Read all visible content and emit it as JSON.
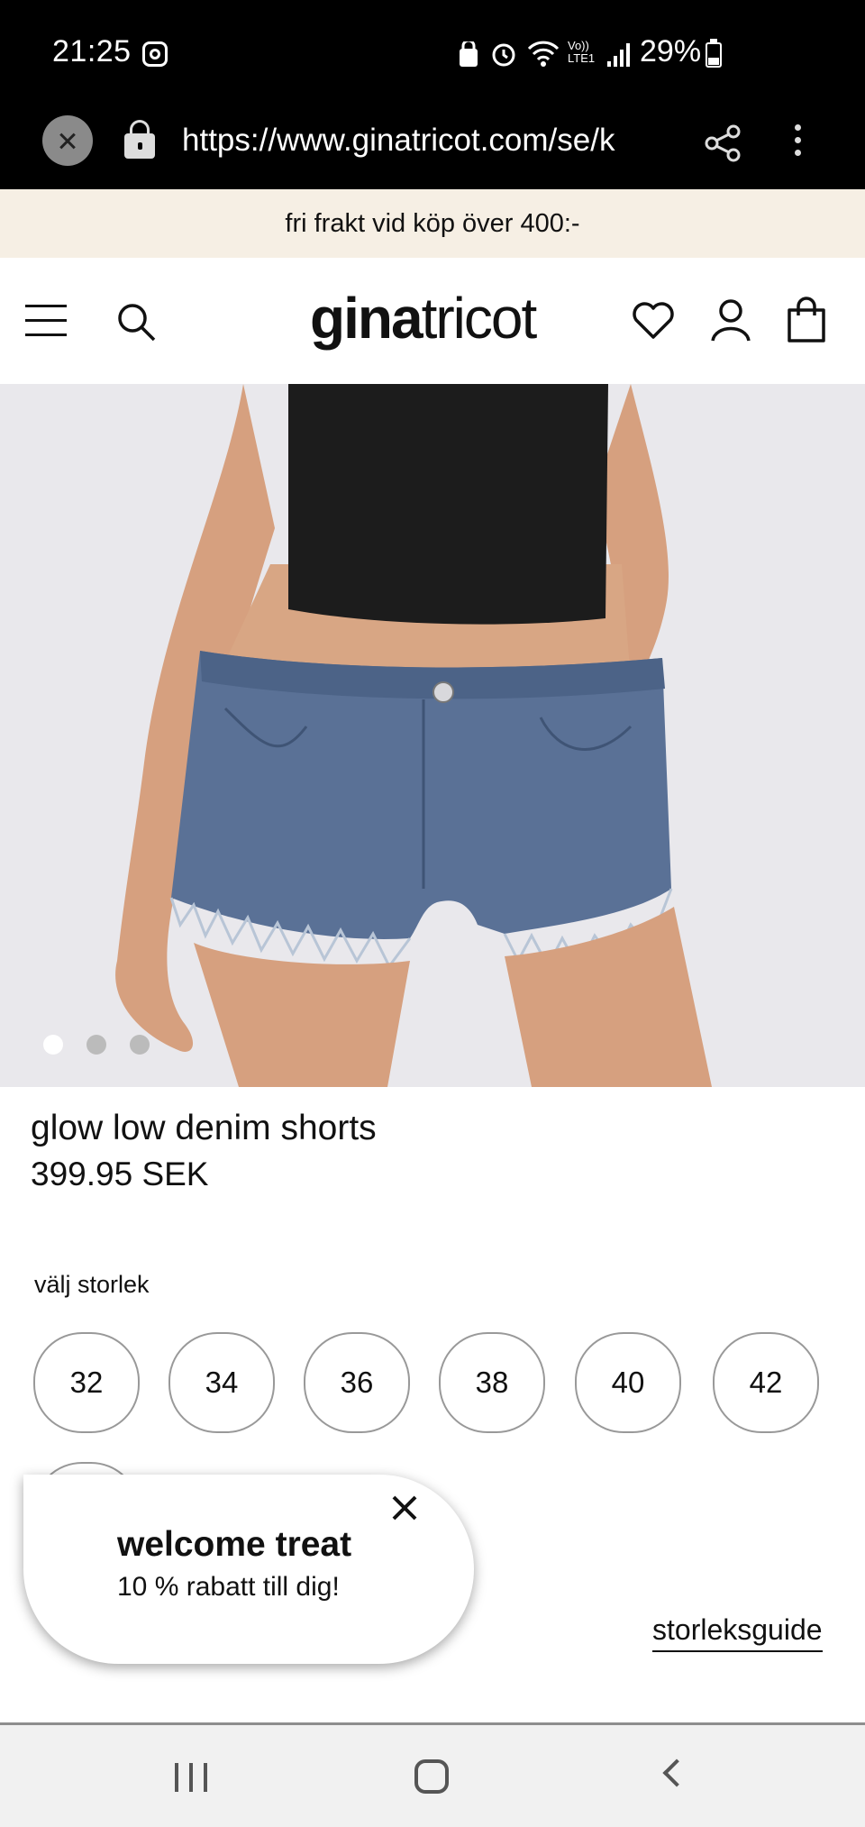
{
  "status_bar": {
    "time": "21:25",
    "network": "Vo)) LTE1",
    "battery": "29%"
  },
  "browser": {
    "url": "https://www.ginatricot.com/se/k"
  },
  "promo": {
    "text": "fri frakt vid köp över 400:-"
  },
  "header": {
    "logo_bold": "gina",
    "logo_light": "tricot"
  },
  "product": {
    "name": "glow low denim shorts",
    "price": "399.95 SEK",
    "image_count": 3,
    "active_image": 1
  },
  "sizes": {
    "label": "välj storlek",
    "options": [
      "32",
      "34",
      "36",
      "38",
      "40",
      "42"
    ],
    "guide_label": "storleksguide"
  },
  "popup": {
    "title": "welcome treat",
    "subtitle": "10 % rabatt till dig!"
  },
  "colors": {
    "promo_bg": "#f6efe4",
    "image_bg": "#e9e8ec",
    "denim": "#5a7196",
    "text": "#111111"
  }
}
